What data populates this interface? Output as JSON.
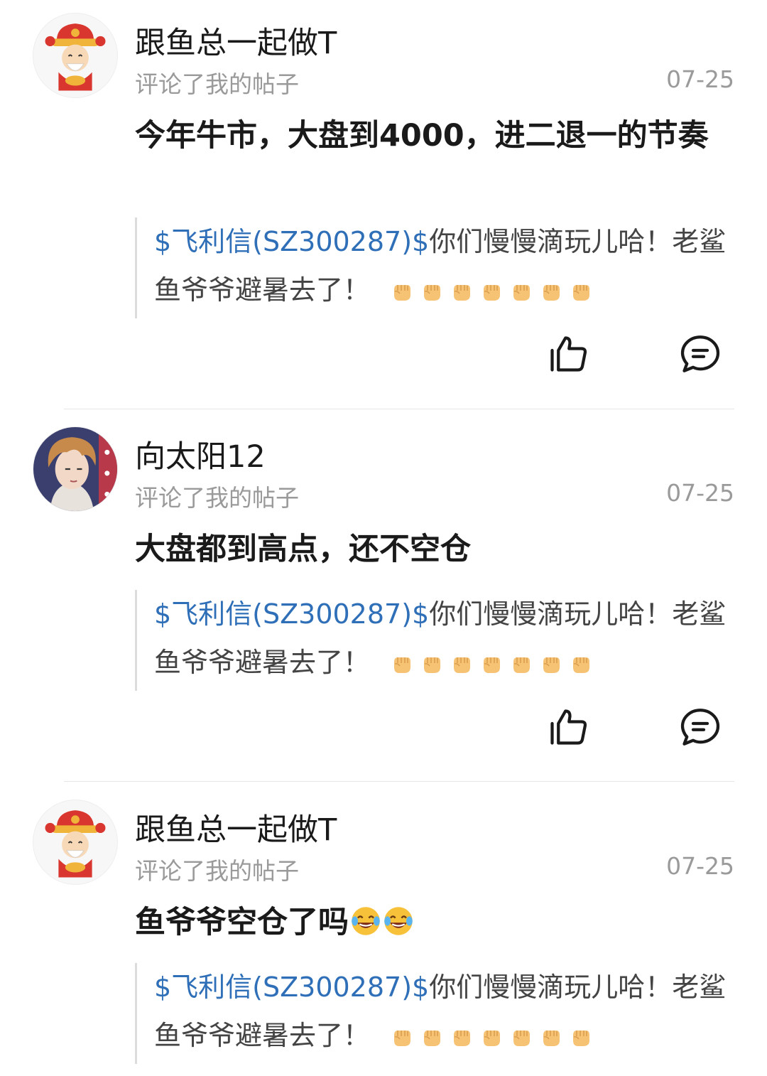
{
  "notifications": [
    {
      "username": "跟鱼总一起做T",
      "action": "评论了我的帖子",
      "date": "07-25",
      "avatar_icon": "fortune-god-avatar",
      "comment": "今年牛市，大盘到4000，进二退一的节奏",
      "comment_emojis": [],
      "quote_link": "$飞利信(SZ300287)$",
      "quote_text": "你们慢慢滴玩儿哈！老鲨鱼爷爷避暑去了！",
      "quote_emoji": "fist-emoji",
      "quote_emoji_count": 7
    },
    {
      "username": "向太阳12",
      "action": "评论了我的帖子",
      "date": "07-25",
      "avatar_icon": "anime-boy-avatar",
      "comment": "大盘都到高点，还不空仓",
      "comment_emojis": [],
      "quote_link": "$飞利信(SZ300287)$",
      "quote_text": "你们慢慢滴玩儿哈！老鲨鱼爷爷避暑去了！",
      "quote_emoji": "fist-emoji",
      "quote_emoji_count": 7
    },
    {
      "username": "跟鱼总一起做T",
      "action": "评论了我的帖子",
      "date": "07-25",
      "avatar_icon": "fortune-god-avatar",
      "comment": "鱼爷爷空仓了吗",
      "comment_emojis": [
        "laughing-tears-emoji",
        "laughing-tears-emoji"
      ],
      "quote_link": "$飞利信(SZ300287)$",
      "quote_text": "你们慢慢滴玩儿哈！老鲨鱼爷爷避暑去了！",
      "quote_emoji": "fist-emoji",
      "quote_emoji_count": 7
    }
  ],
  "icons": {
    "like": "thumbs-up-icon",
    "reply": "comment-bubble-icon"
  },
  "colors": {
    "link": "#2f6fb8",
    "meta": "#9a9a9a",
    "fist": "#f6c274"
  }
}
